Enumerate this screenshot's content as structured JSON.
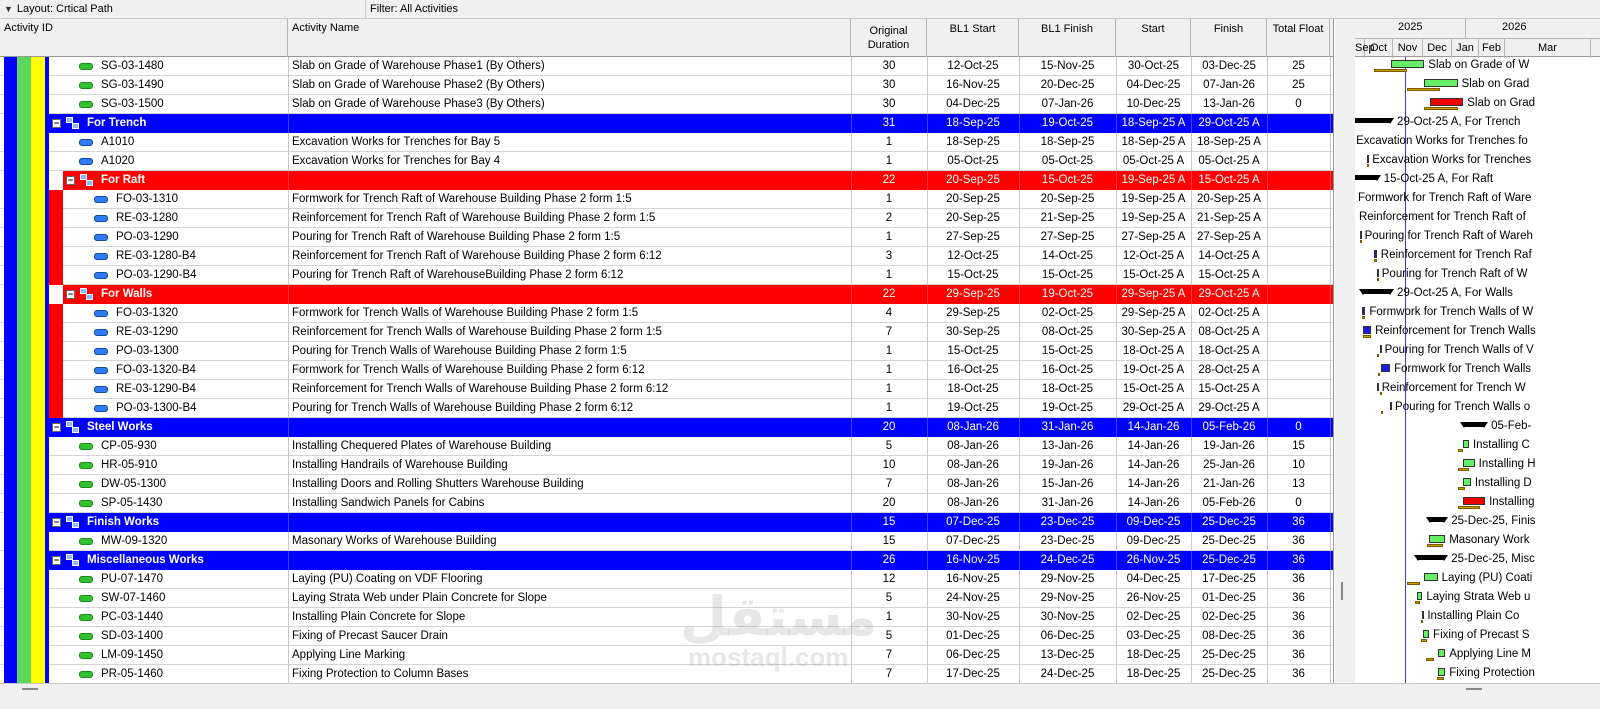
{
  "toolbar": {
    "layout_label": "Layout: Crtical Path",
    "filter_label": "Filter: All Activities"
  },
  "columns": {
    "activity_id": "Activity ID",
    "activity_name": "Activity Name",
    "original_duration": "Original Duration",
    "bl1_start": "BL1 Start",
    "bl1_finish": "BL1 Finish",
    "start": "Start",
    "finish": "Finish",
    "total_float": "Total Float"
  },
  "gantt_header": {
    "years": [
      "2025",
      "2026"
    ],
    "months": [
      "Sep",
      "Oct",
      "Nov",
      "Dec",
      "Jan",
      "Feb",
      "Mar"
    ]
  },
  "rows": [
    {
      "type": "activity",
      "level": 1,
      "icon": "green",
      "id": "SG-03-1480",
      "name": "Slab on Grade of Warehouse Phase1 (By Others)",
      "dur": "30",
      "bl1s": "12-Oct-25",
      "bl1f": "15-Nov-25",
      "start": "30-Oct-25",
      "finish": "03-Dec-25",
      "tf": "25",
      "gantt_label": "Slab on Grade of W"
    },
    {
      "type": "activity",
      "level": 1,
      "icon": "green",
      "id": "SG-03-1490",
      "name": "Slab on Grade of Warehouse Phase2 (By Others)",
      "dur": "30",
      "bl1s": "16-Nov-25",
      "bl1f": "20-Dec-25",
      "start": "04-Dec-25",
      "finish": "07-Jan-26",
      "tf": "25",
      "gantt_label": "Slab on Grad"
    },
    {
      "type": "activity",
      "level": 1,
      "icon": "green",
      "id": "SG-03-1500",
      "name": "Slab on Grade of Warehouse Phase3 (By Others)",
      "dur": "30",
      "bl1s": "04-Dec-25",
      "bl1f": "07-Jan-26",
      "start": "10-Dec-25",
      "finish": "13-Jan-26",
      "tf": "0",
      "gantt_label": "Slab on Grad"
    },
    {
      "type": "wbs",
      "color": "blue",
      "level": 1,
      "name": "For Trench",
      "dur": "31",
      "bl1s": "18-Sep-25",
      "bl1f": "19-Oct-25",
      "start": "18-Sep-25 A",
      "finish": "29-Oct-25 A",
      "tf": "",
      "gantt_label": "29-Oct-25 A, For Trench"
    },
    {
      "type": "activity",
      "level": 2,
      "icon": "blue",
      "id": "A1010",
      "name": "Excavation Works for Trenches for Bay 5",
      "dur": "1",
      "bl1s": "18-Sep-25",
      "bl1f": "18-Sep-25",
      "start": "18-Sep-25 A",
      "finish": "18-Sep-25 A",
      "tf": "",
      "gantt_label": "Excavation Works for Trenches fo"
    },
    {
      "type": "activity",
      "level": 2,
      "icon": "blue",
      "id": "A1020",
      "name": "Excavation Works for Trenches for Bay 4",
      "dur": "1",
      "bl1s": "05-Oct-25",
      "bl1f": "05-Oct-25",
      "start": "05-Oct-25 A",
      "finish": "05-Oct-25 A",
      "tf": "",
      "gantt_label": "Excavation Works for Trenches"
    },
    {
      "type": "wbs",
      "color": "red",
      "level": 2,
      "name": "For Raft",
      "dur": "22",
      "bl1s": "20-Sep-25",
      "bl1f": "15-Oct-25",
      "start": "19-Sep-25 A",
      "finish": "15-Oct-25 A",
      "tf": "",
      "gantt_label": "15-Oct-25 A, For Raft"
    },
    {
      "type": "activity",
      "level": 3,
      "icon": "blue",
      "id": "FO-03-1310",
      "name": "Formwork for Trench Raft of Warehouse Building Phase 2 form 1:5",
      "dur": "1",
      "bl1s": "20-Sep-25",
      "bl1f": "20-Sep-25",
      "start": "19-Sep-25 A",
      "finish": "20-Sep-25 A",
      "tf": "",
      "gantt_label": "Formwork for Trench Raft of Ware"
    },
    {
      "type": "activity",
      "level": 3,
      "icon": "blue",
      "id": "RE-03-1280",
      "name": "Reinforcement for Trench Raft of Warehouse Building Phase 2 form 1:5",
      "dur": "2",
      "bl1s": "20-Sep-25",
      "bl1f": "21-Sep-25",
      "start": "19-Sep-25 A",
      "finish": "21-Sep-25 A",
      "tf": "",
      "gantt_label": "Reinforcement for Trench Raft of"
    },
    {
      "type": "activity",
      "level": 3,
      "icon": "blue",
      "id": "PO-03-1290",
      "name": "Pouring for Trench Raft of Warehouse Building Phase 2 form 1:5",
      "dur": "1",
      "bl1s": "27-Sep-25",
      "bl1f": "27-Sep-25",
      "start": "27-Sep-25 A",
      "finish": "27-Sep-25 A",
      "tf": "",
      "gantt_label": "Pouring for Trench Raft of Wareh"
    },
    {
      "type": "activity",
      "level": 3,
      "icon": "blue",
      "id": "RE-03-1280-B4",
      "name": "Reinforcement for Trench Raft of Warehouse Building Phase 2 form 6:12",
      "dur": "3",
      "bl1s": "12-Oct-25",
      "bl1f": "14-Oct-25",
      "start": "12-Oct-25 A",
      "finish": "14-Oct-25 A",
      "tf": "",
      "gantt_label": "Reinforcement for Trench Raf"
    },
    {
      "type": "activity",
      "level": 3,
      "icon": "blue",
      "id": "PO-03-1290-B4",
      "name": "Pouring for Trench Raft of WarehouseBuilding Phase 2 form 6:12",
      "dur": "1",
      "bl1s": "15-Oct-25",
      "bl1f": "15-Oct-25",
      "start": "15-Oct-25 A",
      "finish": "15-Oct-25 A",
      "tf": "",
      "gantt_label": "Pouring for Trench Raft of W"
    },
    {
      "type": "wbs",
      "color": "red",
      "level": 2,
      "name": "For Walls",
      "dur": "22",
      "bl1s": "29-Sep-25",
      "bl1f": "19-Oct-25",
      "start": "29-Sep-25 A",
      "finish": "29-Oct-25 A",
      "tf": "",
      "gantt_label": "29-Oct-25 A, For Walls"
    },
    {
      "type": "activity",
      "level": 3,
      "icon": "blue",
      "id": "FO-03-1320",
      "name": "Formwork for Trench Walls of Warehouse Building Phase 2 form 1:5",
      "dur": "4",
      "bl1s": "29-Sep-25",
      "bl1f": "02-Oct-25",
      "start": "29-Sep-25 A",
      "finish": "02-Oct-25 A",
      "tf": "",
      "gantt_label": "Formwork for Trench Walls of W"
    },
    {
      "type": "activity",
      "level": 3,
      "icon": "blue",
      "id": "RE-03-1290",
      "name": "Reinforcement for Trench Walls of Warehouse Building Phase 2 form 1:5",
      "dur": "7",
      "bl1s": "30-Sep-25",
      "bl1f": "08-Oct-25",
      "start": "30-Sep-25 A",
      "finish": "08-Oct-25 A",
      "tf": "",
      "gantt_label": "Reinforcement for Trench Walls"
    },
    {
      "type": "activity",
      "level": 3,
      "icon": "blue",
      "id": "PO-03-1300",
      "name": "Pouring for Trench Walls of Warehouse Building Phase 2 form 1:5",
      "dur": "1",
      "bl1s": "15-Oct-25",
      "bl1f": "15-Oct-25",
      "start": "18-Oct-25 A",
      "finish": "18-Oct-25 A",
      "tf": "",
      "gantt_label": "Pouring for Trench Walls of V"
    },
    {
      "type": "activity",
      "level": 3,
      "icon": "blue",
      "id": "FO-03-1320-B4",
      "name": "Formwork for Trench Walls of Warehouse Building Phase 2 form 6:12",
      "dur": "1",
      "bl1s": "16-Oct-25",
      "bl1f": "16-Oct-25",
      "start": "19-Oct-25 A",
      "finish": "28-Oct-25 A",
      "tf": "",
      "gantt_label": "Formwork for Trench Walls"
    },
    {
      "type": "activity",
      "level": 3,
      "icon": "blue",
      "id": "RE-03-1290-B4",
      "name": "Reinforcement for Trench Walls of Warehouse Building Phase 2 form 6:12",
      "dur": "1",
      "bl1s": "18-Oct-25",
      "bl1f": "18-Oct-25",
      "start": "15-Oct-25 A",
      "finish": "15-Oct-25 A",
      "tf": "",
      "gantt_label": "Reinforcement for Trench W"
    },
    {
      "type": "activity",
      "level": 3,
      "icon": "blue",
      "id": "PO-03-1300-B4",
      "name": "Pouring for Trench Walls of Warehouse Building Phase 2 form 6:12",
      "dur": "1",
      "bl1s": "19-Oct-25",
      "bl1f": "19-Oct-25",
      "start": "29-Oct-25 A",
      "finish": "29-Oct-25 A",
      "tf": "",
      "gantt_label": "Pouring for Trench Walls o"
    },
    {
      "type": "wbs",
      "color": "blue",
      "level": 1,
      "name": "Steel Works",
      "dur": "20",
      "bl1s": "08-Jan-26",
      "bl1f": "31-Jan-26",
      "start": "14-Jan-26",
      "finish": "05-Feb-26",
      "tf": "0",
      "gantt_label": "05-Feb-"
    },
    {
      "type": "activity",
      "level": 1,
      "icon": "green",
      "id": "CP-05-930",
      "name": "Installing Chequered Plates of Warehouse Building",
      "dur": "5",
      "bl1s": "08-Jan-26",
      "bl1f": "13-Jan-26",
      "start": "14-Jan-26",
      "finish": "19-Jan-26",
      "tf": "15",
      "gantt_label": "Installing C"
    },
    {
      "type": "activity",
      "level": 1,
      "icon": "green",
      "id": "HR-05-910",
      "name": "Installing Handrails of Warehouse Building",
      "dur": "10",
      "bl1s": "08-Jan-26",
      "bl1f": "19-Jan-26",
      "start": "14-Jan-26",
      "finish": "25-Jan-26",
      "tf": "10",
      "gantt_label": "Installing H"
    },
    {
      "type": "activity",
      "level": 1,
      "icon": "green",
      "id": "DW-05-1300",
      "name": "Installing Doors and Rolling Shutters Warehouse Building",
      "dur": "7",
      "bl1s": "08-Jan-26",
      "bl1f": "15-Jan-26",
      "start": "14-Jan-26",
      "finish": "21-Jan-26",
      "tf": "13",
      "gantt_label": "Installing D"
    },
    {
      "type": "activity",
      "level": 1,
      "icon": "green",
      "id": "SP-05-1430",
      "name": "Installing Sandwich Panels for Cabins",
      "dur": "20",
      "bl1s": "08-Jan-26",
      "bl1f": "31-Jan-26",
      "start": "14-Jan-26",
      "finish": "05-Feb-26",
      "tf": "0",
      "gantt_label": "Installing"
    },
    {
      "type": "wbs",
      "color": "blue",
      "level": 1,
      "name": "Finish Works",
      "dur": "15",
      "bl1s": "07-Dec-25",
      "bl1f": "23-Dec-25",
      "start": "09-Dec-25",
      "finish": "25-Dec-25",
      "tf": "36",
      "gantt_label": "25-Dec-25, Finis"
    },
    {
      "type": "activity",
      "level": 1,
      "icon": "green",
      "id": "MW-09-1320",
      "name": "Masonary Works of Warehouse Building",
      "dur": "15",
      "bl1s": "07-Dec-25",
      "bl1f": "23-Dec-25",
      "start": "09-Dec-25",
      "finish": "25-Dec-25",
      "tf": "36",
      "gantt_label": "Masonary Work"
    },
    {
      "type": "wbs",
      "color": "blue",
      "level": 1,
      "name": "Miscellaneous Works",
      "dur": "26",
      "bl1s": "16-Nov-25",
      "bl1f": "24-Dec-25",
      "start": "26-Nov-25",
      "finish": "25-Dec-25",
      "tf": "36",
      "gantt_label": "25-Dec-25, Misc"
    },
    {
      "type": "activity",
      "level": 1,
      "icon": "green",
      "id": "PU-07-1470",
      "name": "Laying (PU) Coating on VDF Flooring",
      "dur": "12",
      "bl1s": "16-Nov-25",
      "bl1f": "29-Nov-25",
      "start": "04-Dec-25",
      "finish": "17-Dec-25",
      "tf": "36",
      "gantt_label": "Laying (PU) Coati"
    },
    {
      "type": "activity",
      "level": 1,
      "icon": "green",
      "id": "SW-07-1460",
      "name": "Laying Strata Web under Plain Concrete for Slope",
      "dur": "5",
      "bl1s": "24-Nov-25",
      "bl1f": "29-Nov-25",
      "start": "26-Nov-25",
      "finish": "01-Dec-25",
      "tf": "36",
      "gantt_label": "Laying Strata Web u"
    },
    {
      "type": "activity",
      "level": 1,
      "icon": "green",
      "id": "PC-03-1440",
      "name": "Installing Plain Concrete for Slope",
      "dur": "1",
      "bl1s": "30-Nov-25",
      "bl1f": "30-Nov-25",
      "start": "02-Dec-25",
      "finish": "02-Dec-25",
      "tf": "36",
      "gantt_label": "Installing Plain Co"
    },
    {
      "type": "activity",
      "level": 1,
      "icon": "green",
      "id": "SD-03-1400",
      "name": "Fixing of Precast Saucer Drain",
      "dur": "5",
      "bl1s": "01-Dec-25",
      "bl1f": "06-Dec-25",
      "start": "03-Dec-25",
      "finish": "08-Dec-25",
      "tf": "36",
      "gantt_label": "Fixing of Precast S"
    },
    {
      "type": "activity",
      "level": 1,
      "icon": "green",
      "id": "LM-09-1450",
      "name": "Applying Line Marking",
      "dur": "7",
      "bl1s": "06-Dec-25",
      "bl1f": "13-Dec-25",
      "start": "18-Dec-25",
      "finish": "25-Dec-25",
      "tf": "36",
      "gantt_label": "Applying Line M"
    },
    {
      "type": "activity",
      "level": 1,
      "icon": "green",
      "id": "PR-05-1460",
      "name": "Fixing Protection to Column Bases",
      "dur": "7",
      "bl1s": "17-Dec-25",
      "bl1f": "24-Dec-25",
      "start": "18-Dec-25",
      "finish": "25-Dec-25",
      "tf": "36",
      "gantt_label": "Fixing Protection"
    }
  ],
  "watermark": {
    "arabic": "مستقل",
    "latin": "mostaql.com"
  },
  "colors": {
    "wbs_blue": "#0000ff",
    "wbs_red": "#ff0000",
    "bar_green": "#66ee66",
    "bar_red": "#ee0000",
    "bar_blue": "#1a1ae0"
  }
}
